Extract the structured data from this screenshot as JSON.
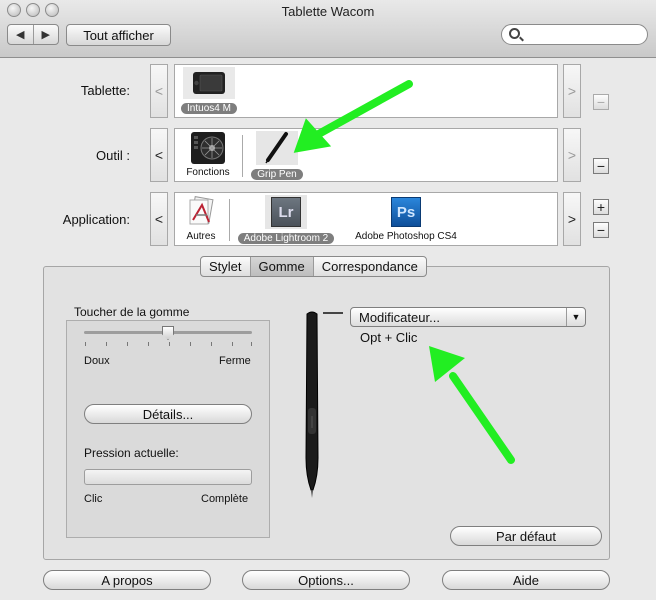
{
  "window": {
    "title": "Tablette Wacom"
  },
  "toolbar": {
    "back_glyph": "◀",
    "forward_glyph": "▶",
    "show_all_label": "Tout afficher",
    "search_placeholder": ""
  },
  "rows": {
    "tablette": {
      "label": "Tablette:",
      "scroll_left": "<",
      "scroll_right": ">",
      "items": [
        {
          "caption": "Intuos4 M",
          "selected": true
        }
      ],
      "remove_glyph": "−"
    },
    "outil": {
      "label": "Outil :",
      "scroll_left": "<",
      "scroll_right": ">",
      "items": [
        {
          "caption": "Fonctions",
          "selected": false
        },
        {
          "caption": "Grip Pen",
          "selected": true
        }
      ],
      "remove_glyph": "−"
    },
    "application": {
      "label": "Application:",
      "scroll_left": "<",
      "scroll_right": ">",
      "items": [
        {
          "caption": "Autres",
          "selected": false
        },
        {
          "caption": "Adobe Lightroom 2",
          "selected": true,
          "icon_text": "Lr"
        },
        {
          "caption": "Adobe Photoshop CS4",
          "selected": false,
          "icon_text": "Ps"
        }
      ],
      "add_glyph": "+",
      "remove_glyph": "−"
    }
  },
  "tabs": [
    {
      "label": "Stylet",
      "active": false
    },
    {
      "label": "Gomme",
      "active": true
    },
    {
      "label": "Correspondance",
      "active": false
    }
  ],
  "eraser": {
    "section_label": "Toucher de la gomme",
    "slider": {
      "min_label": "Doux",
      "max_label": "Ferme",
      "value": 0.5
    },
    "details_label": "Détails...",
    "pressure_label": "Pression actuelle:",
    "pressure_min": "Clic",
    "pressure_max": "Complète",
    "pressure_value": 0
  },
  "modifier": {
    "popup_value": "Modificateur...",
    "subtext": "Opt + Clic"
  },
  "buttons": {
    "defaults": "Par défaut",
    "about": "A propos",
    "options": "Options...",
    "help": "Aide"
  },
  "colors": {
    "arrow": "#22ee22",
    "selected_caption_bg": "#7e7e7e",
    "ps_blue": "#1c6fc4",
    "lr_gray": "#5e6670"
  }
}
